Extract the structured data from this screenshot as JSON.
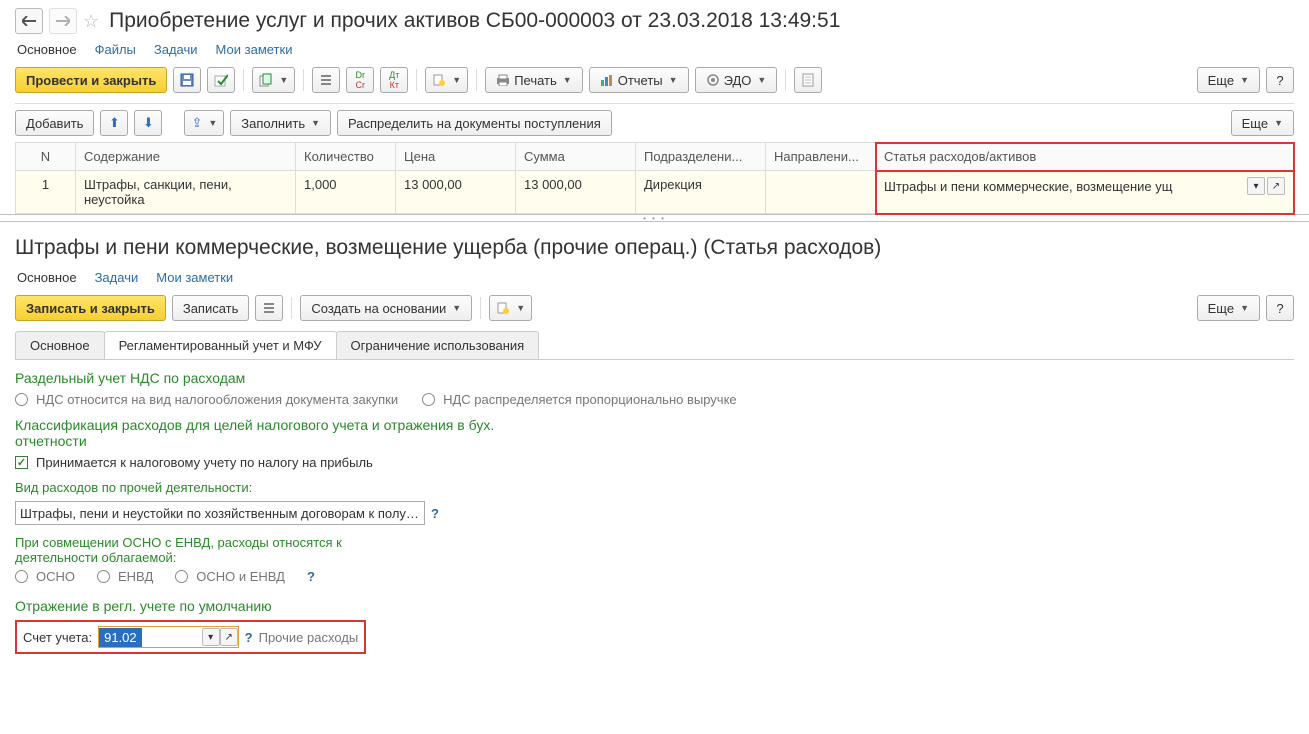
{
  "doc1": {
    "title": "Приобретение услуг и прочих активов СБ00-000003 от 23.03.2018 13:49:51",
    "tabs": [
      "Основное",
      "Файлы",
      "Задачи",
      "Мои заметки"
    ],
    "toolbar": {
      "post_close": "Провести и закрыть",
      "print": "Печать",
      "reports": "Отчеты",
      "edo": "ЭДО",
      "more": "Еще"
    },
    "tbl_toolbar": {
      "add": "Добавить",
      "fill": "Заполнить",
      "distribute": "Распределить на документы поступления",
      "more": "Еще"
    },
    "cols": {
      "n": "N",
      "content": "Содержание",
      "qty": "Количество",
      "price": "Цена",
      "sum": "Сумма",
      "dept": "Подразделени...",
      "dir": "Направлени...",
      "article": "Статья расходов/активов"
    },
    "row": {
      "n": "1",
      "content": "Штрафы, санкции, пени, неустойка",
      "qty": "1,000",
      "price": "13 000,00",
      "sum": "13 000,00",
      "dept": "Дирекция",
      "dir": "",
      "article": "Штрафы и пени коммерческие, возмещение ущ"
    }
  },
  "doc2": {
    "title": "Штрафы и пени коммерческие, возмещение ущерба (прочие операц.) (Статья расходов)",
    "tabs": [
      "Основное",
      "Задачи",
      "Мои заметки"
    ],
    "toolbar": {
      "save_close": "Записать и закрыть",
      "save": "Записать",
      "create_based": "Создать на основании",
      "more": "Еще"
    },
    "form_tabs": [
      "Основное",
      "Регламентированный учет и МФУ",
      "Ограничение использования"
    ],
    "sect_vat": "Раздельный учет НДС по расходам",
    "vat_opt1": "НДС относится на вид налогообложения документа закупки",
    "vat_opt2": "НДС распределяется пропорционально выручке",
    "sect_class": "Классификация расходов для целей налогового учета и отражения в бух. отчетности",
    "chk_tax": "Принимается к налоговому учету по налогу на прибыль",
    "lbl_activity": "Вид расходов по прочей деятельности:",
    "activity_val": "Штрафы, пени и неустойки по хозяйственным договорам к получен",
    "lbl_osno": "При совмещении ОСНО с ЕНВД, расходы относятся к деятельности облагаемой:",
    "osno_opts": [
      "ОСНО",
      "ЕНВД",
      "ОСНО и ЕНВД"
    ],
    "sect_acct": "Отражение в регл. учете по умолчанию",
    "lbl_account": "Счет учета:",
    "account_val": "91.02",
    "account_desc": "Прочие расходы"
  }
}
